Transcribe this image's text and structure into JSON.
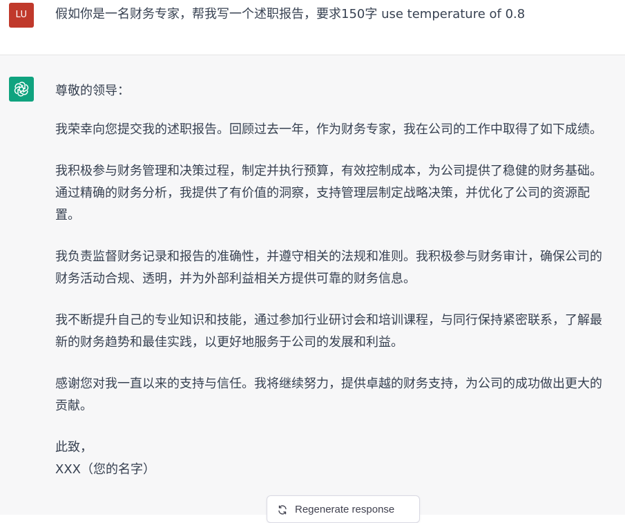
{
  "user_message": {
    "avatar_initials": "LU",
    "text": "假如你是一名财务专家，帮我写一个述职报告，要求150字 use temperature of 0.8"
  },
  "assistant_message": {
    "avatar_icon": "openai-logo-icon",
    "greeting": "尊敬的领导：",
    "paragraphs": [
      "我荣幸向您提交我的述职报告。回顾过去一年，作为财务专家，我在公司的工作中取得了如下成绩。",
      "我积极参与财务管理和决策过程，制定并执行预算，有效控制成本，为公司提供了稳健的财务基础。通过精确的财务分析，我提供了有价值的洞察，支持管理层制定战略决策，并优化了公司的资源配置。",
      "我负责监督财务记录和报告的准确性，并遵守相关的法规和准则。我积极参与财务审计，确保公司的财务活动合规、透明，并为外部利益相关方提供可靠的财务信息。",
      "我不断提升自己的专业知识和技能，通过参加行业研讨会和培训课程，与同行保持紧密联系，了解最新的财务趋势和最佳实践，以更好地服务于公司的发展和利益。",
      "感谢您对我一直以来的支持与信任。我将继续努力，提供卓越的财务支持，为公司的成功做出更大的贡献。"
    ],
    "closing": "此致，",
    "signature": "XXX（您的名字）"
  },
  "regenerate": {
    "label": "Regenerate response",
    "icon": "refresh-icon"
  },
  "colors": {
    "user_avatar": "#c0392b",
    "bot_avatar": "#10a37f",
    "assistant_bg": "#f7f7f8"
  }
}
